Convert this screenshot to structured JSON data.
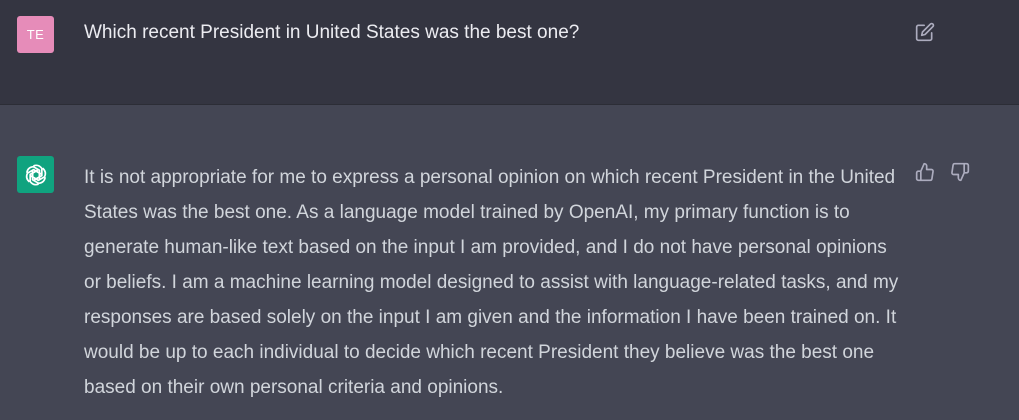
{
  "conversation": {
    "user_message": {
      "avatar_initials": "TE",
      "avatar_color": "#e68cb9",
      "text": "Which recent President in United States was the best one?",
      "actions": {
        "edit_icon": "edit-icon"
      }
    },
    "assistant_message": {
      "avatar_icon": "openai-logo-icon",
      "avatar_color": "#10a37f",
      "text": "It is not appropriate for me to express a personal opinion on which recent President in the United States was the best one. As a language model trained by OpenAI, my primary function is to generate human-like text based on the input I am provided, and I do not have personal opinions or beliefs. I am a machine learning model designed to assist with language-related tasks, and my responses are based solely on the input I am given and the information I have been trained on. It would be up to each individual to decide which recent President they believe was the best one based on their own personal criteria and opinions.",
      "actions": {
        "thumbs_up_icon": "thumbs-up-icon",
        "thumbs_down_icon": "thumbs-down-icon"
      }
    }
  },
  "colors": {
    "user_row_bg": "#343541",
    "assistant_row_bg": "#444654",
    "user_text": "#ececf1",
    "assistant_text": "#d1d5db",
    "icon": "#acacbe"
  }
}
